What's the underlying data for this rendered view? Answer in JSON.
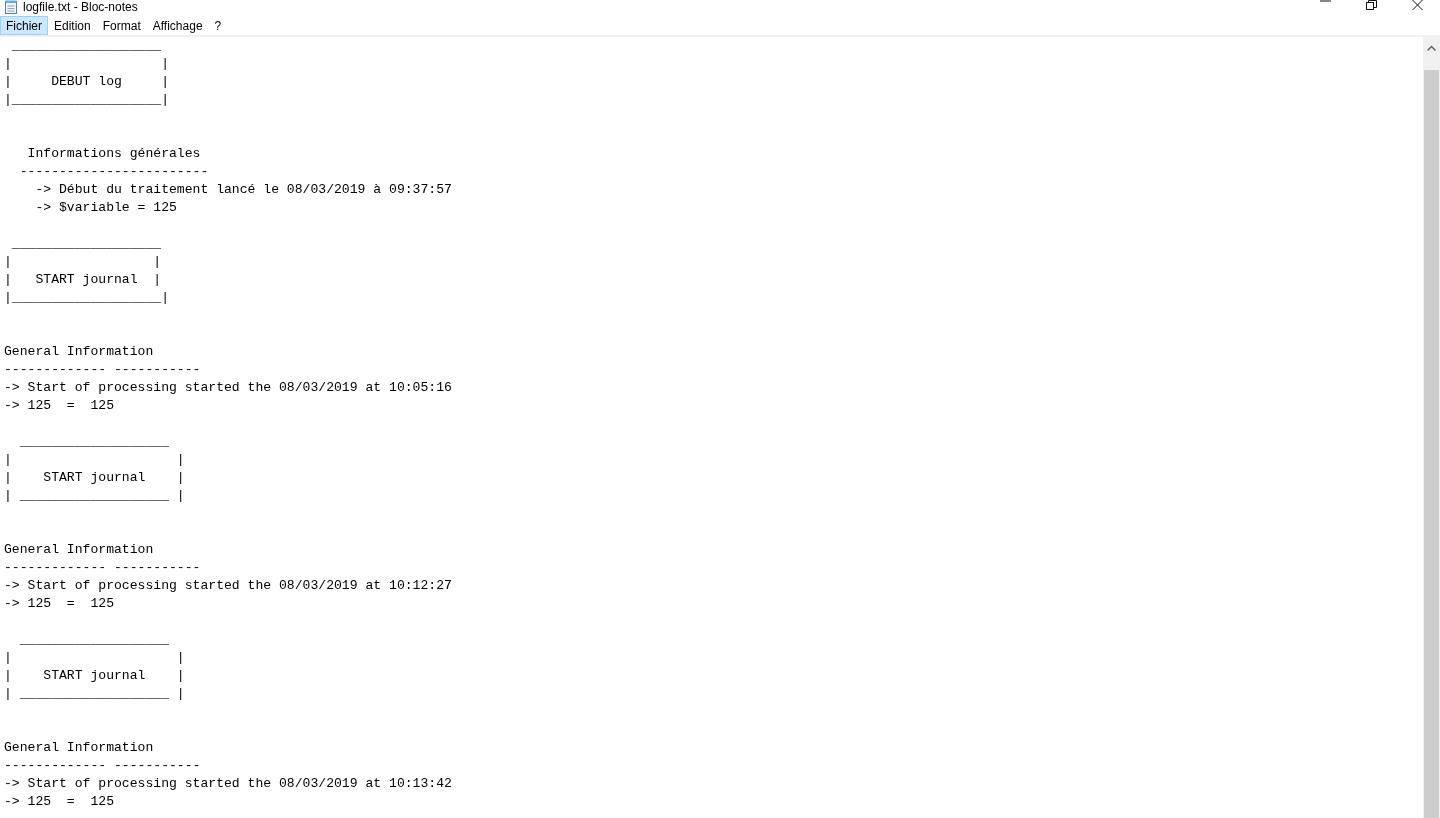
{
  "window": {
    "title": "logfile.txt - Bloc-notes"
  },
  "menu": [
    {
      "label": "Fichier",
      "selected": true
    },
    {
      "label": "Edition",
      "selected": false
    },
    {
      "label": "Format",
      "selected": false
    },
    {
      "label": "Affichage",
      "selected": false
    },
    {
      "label": "?",
      "selected": false
    }
  ],
  "document": {
    "lines": [
      {
        "kind": "text",
        "text": " ___________________"
      },
      {
        "kind": "text",
        "text": "|                   |"
      },
      {
        "kind": "text",
        "text": "|     DEBUT log     |"
      },
      {
        "kind": "text",
        "text": "|___________________|"
      },
      {
        "kind": "blank"
      },
      {
        "kind": "blank"
      },
      {
        "kind": "text",
        "text": "   Informations générales"
      },
      {
        "kind": "text",
        "text": "  ------------------------"
      },
      {
        "kind": "text",
        "text": "    -> Début du traitement lancé le 08/03/2019 à 09:37:57"
      },
      {
        "kind": "text",
        "text": "    -> $variable = 125"
      },
      {
        "kind": "blank"
      },
      {
        "kind": "text",
        "text": " ___________________"
      },
      {
        "kind": "text",
        "text": "|                  |"
      },
      {
        "kind": "text",
        "text": "|   START journal  |"
      },
      {
        "kind": "text",
        "text": "|___________________|"
      },
      {
        "kind": "blank"
      },
      {
        "kind": "blank"
      },
      {
        "kind": "text",
        "text": "General Information"
      },
      {
        "kind": "text",
        "text": "------------- -----------"
      },
      {
        "kind": "text",
        "text": "-> Start of processing started the 08/03/2019 at 10:05:16"
      },
      {
        "kind": "text",
        "text": "-> 125  =  125"
      },
      {
        "kind": "blank"
      },
      {
        "kind": "text",
        "text": "  ___________________"
      },
      {
        "kind": "text",
        "text": "|                     |"
      },
      {
        "kind": "text",
        "text": "|    START journal    |"
      },
      {
        "kind": "text",
        "text": "| ___________________ |"
      },
      {
        "kind": "blank"
      },
      {
        "kind": "blank"
      },
      {
        "kind": "text",
        "text": "General Information"
      },
      {
        "kind": "text",
        "text": "------------- -----------"
      },
      {
        "kind": "text",
        "text": "-> Start of processing started the 08/03/2019 at 10:12:27"
      },
      {
        "kind": "text",
        "text": "-> 125  =  125"
      },
      {
        "kind": "blank"
      },
      {
        "kind": "text",
        "text": "  ___________________"
      },
      {
        "kind": "text",
        "text": "|                     |"
      },
      {
        "kind": "text",
        "text": "|    START journal    |"
      },
      {
        "kind": "text",
        "text": "| ___________________ |"
      },
      {
        "kind": "blank"
      },
      {
        "kind": "blank"
      },
      {
        "kind": "text",
        "text": "General Information"
      },
      {
        "kind": "text",
        "text": "------------- -----------"
      },
      {
        "kind": "text",
        "text": "-> Start of processing started the 08/03/2019 at 10:13:42"
      },
      {
        "kind": "text",
        "text": "-> 125  =  125"
      }
    ]
  }
}
